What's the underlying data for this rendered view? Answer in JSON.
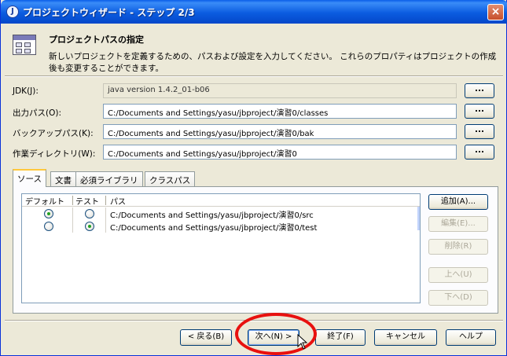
{
  "window": {
    "title": "プロジェクトウィザード - ステップ 2/3",
    "app_icon": "jbuilder-icon",
    "close_label": "×"
  },
  "header": {
    "section_title": "プロジェクトパスの指定",
    "description": "新しいプロジェクトを定義するための、パスおよび設定を入力してください。 これらのプロパティはプロジェクトの作成後も変更することができます。"
  },
  "fields": [
    {
      "label": "JDK(J):",
      "value": "java version 1.4.2_01-b06",
      "readonly": true,
      "button_label": "..."
    },
    {
      "label": "出力パス(O):",
      "value": "C:/Documents and Settings/yasu/jbproject/演習0/classes",
      "readonly": false,
      "button_label": "..."
    },
    {
      "label": "バックアップパス(K):",
      "value": "C:/Documents and Settings/yasu/jbproject/演習0/bak",
      "readonly": false,
      "button_label": "..."
    },
    {
      "label": "作業ディレクトリ(W):",
      "value": "C:/Documents and Settings/yasu/jbproject/演習0",
      "readonly": false,
      "button_label": "..."
    }
  ],
  "tabs": [
    "ソース",
    "文書",
    "必須ライブラリ",
    "クラスパス"
  ],
  "active_tab": "ソース",
  "source_table": {
    "columns": [
      "デフォルト",
      "テスト",
      "パス"
    ],
    "rows": [
      {
        "default": true,
        "test": false,
        "path": "C:/Documents and Settings/yasu/jbproject/演習0/src"
      },
      {
        "default": false,
        "test": true,
        "path": "C:/Documents and Settings/yasu/jbproject/演習0/test"
      }
    ]
  },
  "side_buttons": [
    {
      "label": "追加(A)...",
      "enabled": true
    },
    {
      "label": "編集(E)...",
      "enabled": false
    },
    {
      "label": "削除(R)",
      "enabled": false
    },
    {
      "label": "上へ(U)",
      "enabled": false
    },
    {
      "label": "下へ(D)",
      "enabled": false
    }
  ],
  "footer_buttons": {
    "back": "< 戻る(B)",
    "next": "次へ(N) >",
    "finish": "終了(F)",
    "cancel": "キャンセル",
    "help": "ヘルプ"
  },
  "colors": {
    "title_bar": "#0b5ce0",
    "annotation_circle": "#e8110f",
    "radio_checked": "#21a121",
    "active_tab_accent": "#ffc83c"
  }
}
